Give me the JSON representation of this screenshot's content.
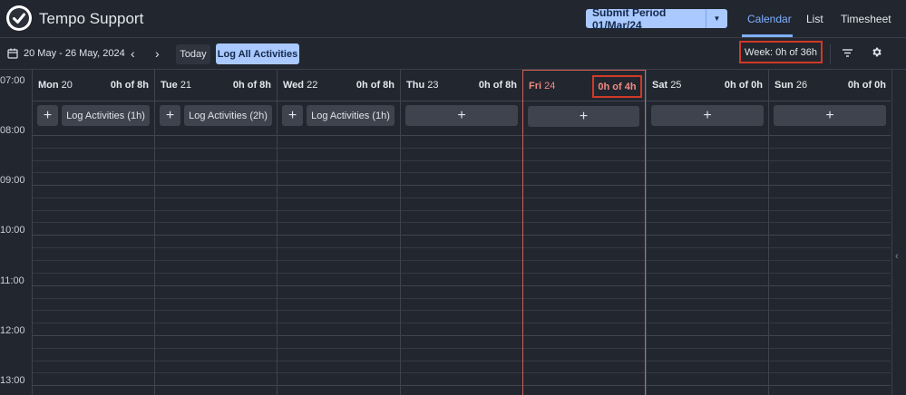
{
  "app": {
    "title": "Tempo Support"
  },
  "header": {
    "submit_label": "Submit Period 01/Mar/24",
    "tabs": [
      "Calendar",
      "List",
      "Timesheet"
    ],
    "active_tab": "Calendar"
  },
  "toolbar": {
    "date_range": "20 May - 26 May, 2024",
    "today_label": "Today",
    "log_all_label": "Log All Activities",
    "week_summary": "Week: 0h of 36h"
  },
  "times": [
    "07:00",
    "08:00",
    "09:00",
    "10:00",
    "11:00",
    "12:00",
    "13:00"
  ],
  "days": [
    {
      "name": "Mon",
      "num": "20",
      "hours": "0h of 8h",
      "log_label": "Log Activities (1h)"
    },
    {
      "name": "Tue",
      "num": "21",
      "hours": "0h of 8h",
      "log_label": "Log Activities (2h)"
    },
    {
      "name": "Wed",
      "num": "22",
      "hours": "0h of 8h",
      "log_label": "Log Activities (1h)"
    },
    {
      "name": "Thu",
      "num": "23",
      "hours": "0h of 8h",
      "log_label": ""
    },
    {
      "name": "Fri",
      "num": "24",
      "hours": "0h of 4h",
      "log_label": ""
    },
    {
      "name": "Sat",
      "num": "25",
      "hours": "0h of 0h",
      "log_label": ""
    },
    {
      "name": "Sun",
      "num": "26",
      "hours": "0h of 0h",
      "log_label": ""
    }
  ],
  "icons": {
    "plus": "+",
    "chevron_left": "‹",
    "chevron_right": "›",
    "collapse": "‹"
  },
  "colors": {
    "accent": "#a9c9ff",
    "active_tab": "#7fb0ff",
    "highlight": "#d03a27",
    "today": "#f28b82"
  }
}
